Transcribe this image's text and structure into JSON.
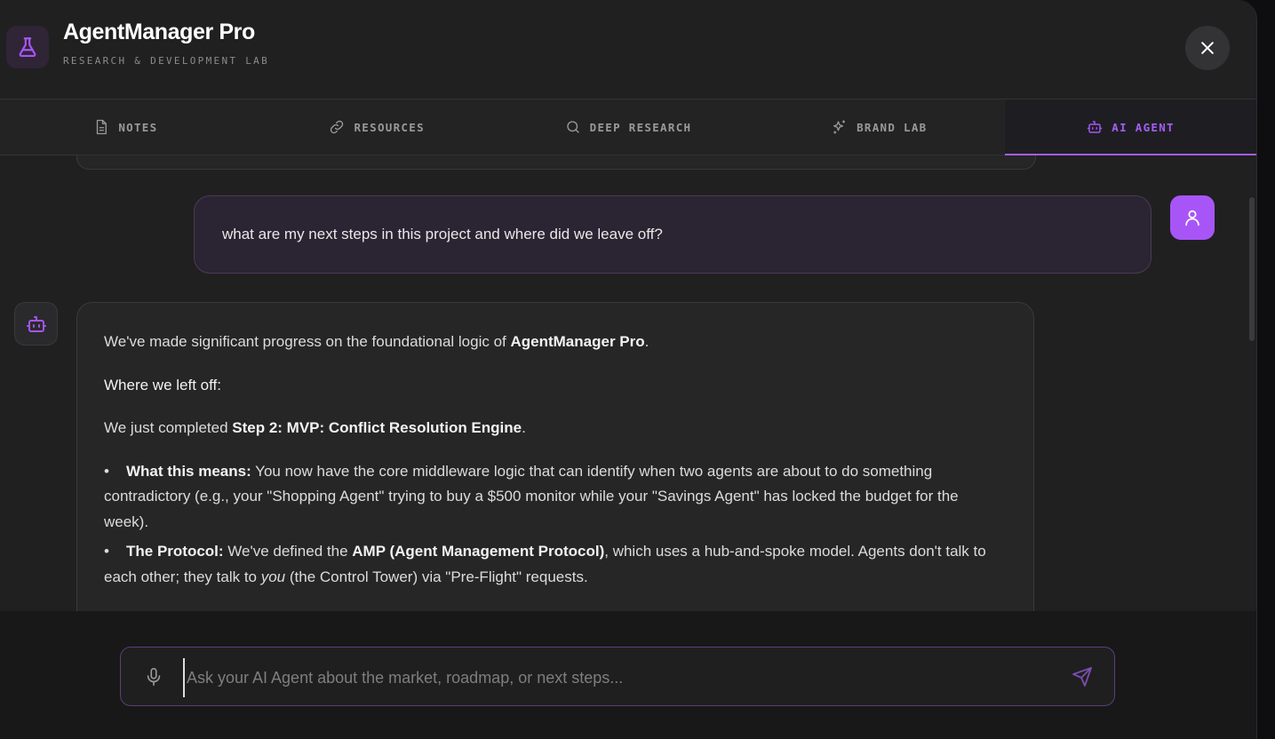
{
  "header": {
    "title": "AgentManager Pro",
    "subtitle": "RESEARCH & DEVELOPMENT LAB",
    "logo_icon": "flask-icon",
    "close_icon": "close-icon"
  },
  "tabs": [
    {
      "label": "NOTES",
      "icon": "document-icon",
      "active": false
    },
    {
      "label": "RESOURCES",
      "icon": "link-icon",
      "active": false
    },
    {
      "label": "DEEP RESEARCH",
      "icon": "search-icon",
      "active": false
    },
    {
      "label": "BRAND LAB",
      "icon": "sparkles-icon",
      "active": false
    },
    {
      "label": "AI AGENT",
      "icon": "bot-icon",
      "active": true
    }
  ],
  "colors": {
    "accent": "#a855f7",
    "background": "#202020",
    "user_bubble": "#2b2433"
  },
  "chat": {
    "user_message": "what are my next steps in this project and where did we leave off?",
    "bot": {
      "p1_before": "We've made significant progress on the foundational logic of ",
      "p1_bold": "AgentManager Pro",
      "p1_after": ".",
      "heading": "Where we left off:",
      "p2_before": "We just completed ",
      "p2_bold": "Step 2: MVP: Conflict Resolution Engine",
      "p2_after": ".",
      "bullet1_bold": "What this means:",
      "bullet1_text": " You now have the core middleware logic that can identify when two agents are about to do something contradictory (e.g., your \"Shopping Agent\" trying to buy a $500 monitor while your \"Savings Agent\" has locked the budget for the week).",
      "bullet2_bold": "The Protocol:",
      "bullet2_text_a": " We've defined the ",
      "bullet2_bold2": "AMP (Agent Management Protocol)",
      "bullet2_text_b": ", which uses a hub-and-spoke model. Agents don't talk to each other; they talk to ",
      "bullet2_italic": "you",
      "bullet2_text_c": " (the Control Tower) via \"Pre-Flight\" requests."
    }
  },
  "composer": {
    "placeholder": "Ask your AI Agent about the market, roadmap, or next steps...",
    "value": ""
  }
}
